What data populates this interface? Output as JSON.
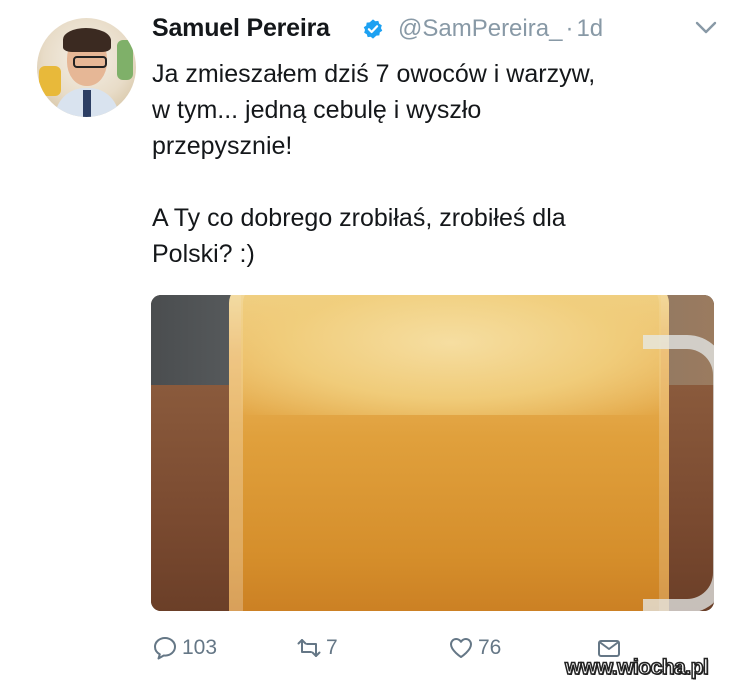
{
  "tweet": {
    "author_name": "Samuel Pereira",
    "handle": "@SamPereira_",
    "separator": "·",
    "time": "1d",
    "text_lines": [
      "Ja zmieszałem dziś 7 owoców i warzyw,",
      "w tym... jedną cebulę i wyszło",
      "przepysznie!",
      "A Ty co dobrego zrobiłaś, zrobiłeś dla",
      "Polski? :)"
    ],
    "actions": {
      "reply_count": "103",
      "retweet_count": "7",
      "like_count": "76"
    }
  },
  "icons": {
    "verified": "verified-badge-icon",
    "caret": "chevron-down-icon",
    "reply": "reply-icon",
    "retweet": "retweet-icon",
    "like": "heart-icon",
    "dm": "envelope-icon"
  },
  "colors": {
    "text": "#14171a",
    "muted": "#8899a6",
    "action": "#657786",
    "verified": "#1da1f2"
  },
  "watermark": "www.wiocha.pl"
}
